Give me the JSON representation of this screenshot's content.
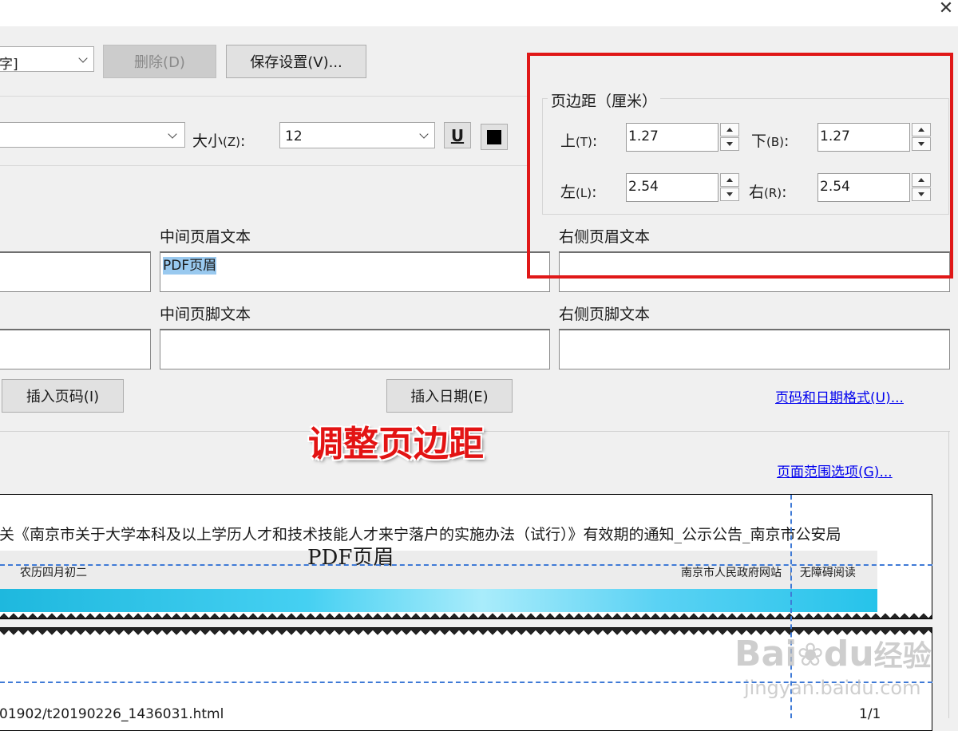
{
  "window": {
    "close_glyph": "✕"
  },
  "toolbar": {
    "preset_value": "字]",
    "delete_label": "删除(D)",
    "save_settings_label": "保存设置(V)..."
  },
  "font": {
    "size_label": "大小",
    "size_mnemonic": "(Z)",
    "size_colon": ":",
    "size_value": "12",
    "underline_glyph": "U"
  },
  "margins": {
    "group_title": "页边距（厘米）",
    "top_label": "上",
    "top_key": "(T)",
    "top_value": "1.27",
    "bottom_label": "下",
    "bottom_key": "(B)",
    "bottom_value": "1.27",
    "left_label": "左",
    "left_key": "(L)",
    "left_value": "2.54",
    "right_label": "右",
    "right_key": "(R)",
    "right_value": "2.54",
    "colon": ":"
  },
  "header": {
    "center_label": "中间页眉文本",
    "center_value": "PDF页眉",
    "right_label": "右侧页眉文本"
  },
  "footer": {
    "center_label": "中间页脚文本",
    "right_label": "右侧页脚文本"
  },
  "actions": {
    "insert_page_number": "插入页码(I)",
    "insert_date": "插入日期(E)",
    "page_date_format_link": "页码和日期格式(U)...",
    "page_range_link": "页面范围选项(G)..."
  },
  "annotation": {
    "text": "调整页边距"
  },
  "preview": {
    "doc_title": "关《南京市关于大学本科及以上学历人才和技术技能人才来宁落户的实施办法（试行）》有效期的通知_公示公告_南京市公安局",
    "header_overlay": "PDF页眉",
    "lunar_date": "农历四月初二",
    "site_links": "南京市人民政府网站 ｜ 无障碍阅读",
    "footer_url": "01902/t20190226_1436031.html",
    "page_count": "1/1"
  },
  "watermark": {
    "brand": "Bai",
    "brand2": "du",
    "brand3": "经验",
    "url": "jingyan.baidu.com"
  },
  "colors": {
    "highlight_box": "#e01818",
    "guide_lines": "#3f7ad6",
    "link": "#0000ee",
    "selection": "#99c9ef"
  }
}
